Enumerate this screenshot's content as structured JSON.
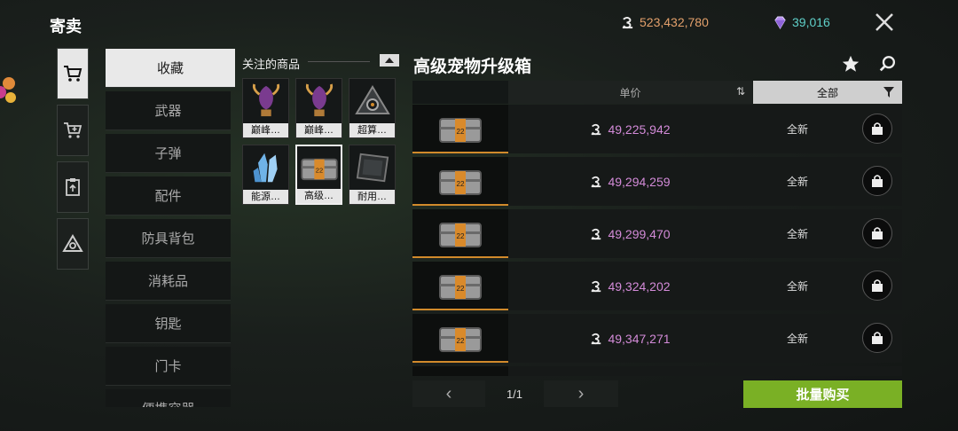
{
  "header": {
    "title": "寄卖",
    "coins": "523,432,780",
    "gems": "39,016",
    "close_icon": "close-icon"
  },
  "colors": {
    "accent_green": "#7ab025",
    "price_purple": "#d38bd8",
    "coin_orange": "#e3a06b",
    "gem_cyan": "#5fd0c9",
    "rarity_orange": "#d18a2b"
  },
  "side_icons": [
    "cart-icon",
    "cart-add-icon",
    "clipboard-upload-icon",
    "logo-triangle-icon"
  ],
  "categories": [
    {
      "label": "收藏",
      "active": true
    },
    {
      "label": "武器"
    },
    {
      "label": "子弹"
    },
    {
      "label": "配件"
    },
    {
      "label": "防具背包"
    },
    {
      "label": "消耗品"
    },
    {
      "label": "钥匙"
    },
    {
      "label": "门卡"
    },
    {
      "label": "便携容器"
    }
  ],
  "watched": {
    "title": "关注的商品",
    "items": [
      {
        "label": "巅峰…",
        "icon": "dragon-trophy-icon",
        "bar": "#d18a2b"
      },
      {
        "label": "巅峰…",
        "icon": "dragon-trophy-icon",
        "bar": "#d18a2b"
      },
      {
        "label": "超算…",
        "icon": "supercomputer-icon",
        "bar": "#d18a2b"
      },
      {
        "label": "能源…",
        "icon": "energy-crystal-icon",
        "bar": "#a14fd0"
      },
      {
        "label": "高级…",
        "icon": "pet-upgrade-box-icon",
        "bar": "#d18a2b",
        "selected": true
      },
      {
        "label": "耐用…",
        "icon": "durable-plate-icon",
        "bar": "#a14fd0"
      }
    ]
  },
  "main": {
    "title": "高级宠物升级箱",
    "col_price": "单价",
    "col_filter": "全部",
    "rows": [
      {
        "price": "49,225,942",
        "condition": "全新"
      },
      {
        "price": "49,294,259",
        "condition": "全新"
      },
      {
        "price": "49,299,470",
        "condition": "全新"
      },
      {
        "price": "49,324,202",
        "condition": "全新"
      },
      {
        "price": "49,347,271",
        "condition": "全新"
      }
    ]
  },
  "pagination": {
    "text": "1/1",
    "prev": "‹",
    "next": "›"
  },
  "bulk_buy": "批量购买"
}
